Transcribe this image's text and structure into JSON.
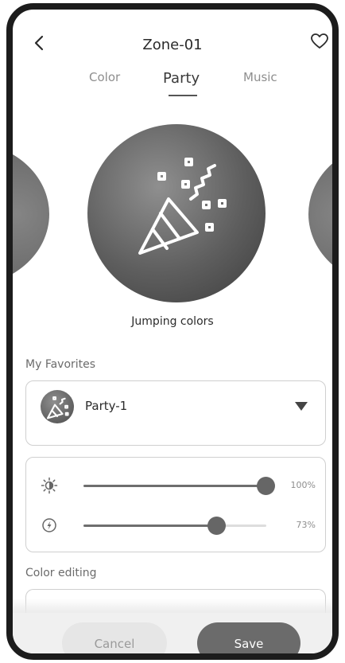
{
  "header": {
    "title": "Zone-01"
  },
  "tabs": [
    {
      "label": "Color",
      "active": false
    },
    {
      "label": "Party",
      "active": true
    },
    {
      "label": "Music",
      "active": false
    }
  ],
  "effect": {
    "caption": "Jumping colors",
    "icon": "party-popper-icon"
  },
  "favorites": {
    "label": "My Favorites",
    "selected": "Party-1"
  },
  "sliders": {
    "brightness": {
      "icon": "brightness-icon",
      "value": 100,
      "text": "100%"
    },
    "speed": {
      "icon": "speed-icon",
      "value": 73,
      "text": "73%"
    }
  },
  "color_editing": {
    "label": "Color editing"
  },
  "footer": {
    "cancel_label": "Cancel",
    "save_label": "Save"
  },
  "colors": {
    "accent": "#6b6b6b",
    "track": "#dddddd",
    "text": "#2b2b2b"
  }
}
